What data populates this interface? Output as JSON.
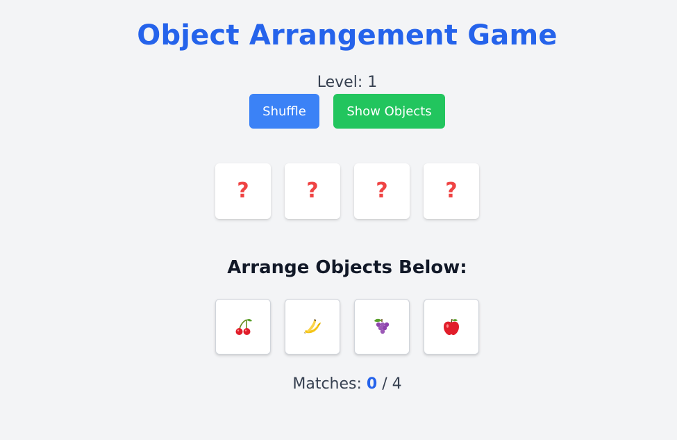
{
  "title": "Object Arrangement Game",
  "level": {
    "label": "Level: ",
    "value": "1"
  },
  "buttons": {
    "shuffle": "Shuffle",
    "show_objects": "Show Objects"
  },
  "colors": {
    "title": "#2563eb",
    "shuffle_button": "#3b82f6",
    "show_button": "#22c55e",
    "hidden_mark": "#ef4444",
    "background": "#f3f4f6"
  },
  "target_slots": [
    {
      "symbol": "?",
      "state": "hidden"
    },
    {
      "symbol": "?",
      "state": "hidden"
    },
    {
      "symbol": "?",
      "state": "hidden"
    },
    {
      "symbol": "?",
      "state": "hidden"
    }
  ],
  "arrange_heading": "Arrange Objects Below:",
  "objects": [
    {
      "icon": "cherry-icon"
    },
    {
      "icon": "banana-icon"
    },
    {
      "icon": "grapes-icon"
    },
    {
      "icon": "apple-icon"
    }
  ],
  "matches": {
    "label": "Matches: ",
    "count": "0",
    "separator": " / ",
    "total": "4"
  }
}
